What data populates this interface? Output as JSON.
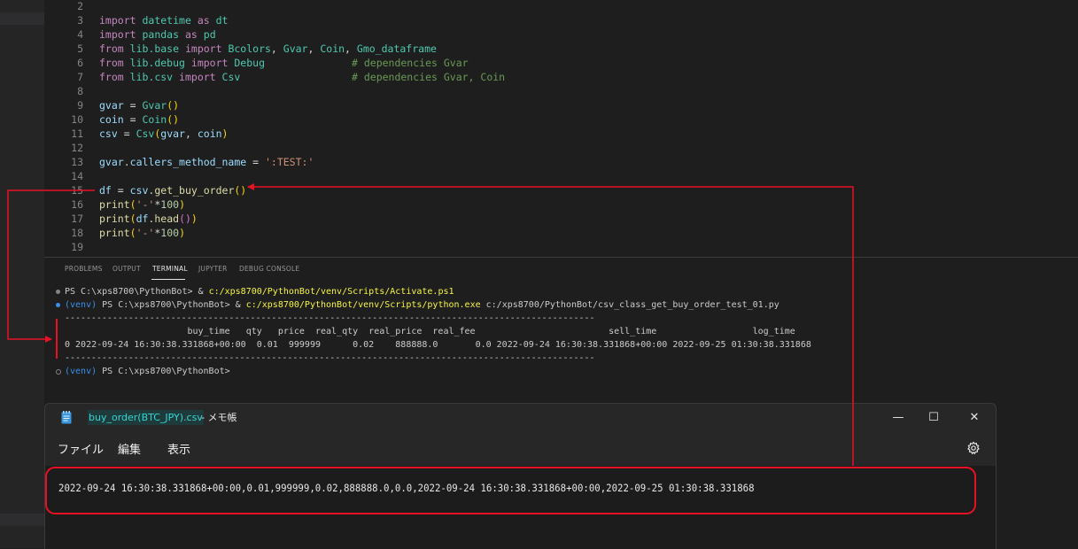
{
  "editor": {
    "lines": [
      {
        "n": "2"
      },
      {
        "n": "3"
      },
      {
        "n": "4"
      },
      {
        "n": "5"
      },
      {
        "n": "6"
      },
      {
        "n": "7"
      },
      {
        "n": "8"
      },
      {
        "n": "9"
      },
      {
        "n": "10"
      },
      {
        "n": "11"
      },
      {
        "n": "12"
      },
      {
        "n": "13"
      },
      {
        "n": "14"
      },
      {
        "n": "15"
      },
      {
        "n": "16"
      },
      {
        "n": "17"
      },
      {
        "n": "18"
      },
      {
        "n": "19"
      }
    ],
    "code": {
      "l3": {
        "kw": "import",
        "mod": "datetime",
        "as": "as",
        "alias": "dt"
      },
      "l4": {
        "kw": "import",
        "mod": "pandas",
        "as": "as",
        "alias": "pd"
      },
      "l5": {
        "from": "from",
        "mod": "lib.base",
        "imp": "import",
        "names": [
          "Bcolors",
          ", ",
          "Gvar",
          ", ",
          "Coin",
          ", ",
          "Gmo_dataframe"
        ]
      },
      "l6": {
        "from": "from",
        "mod": "lib.debug",
        "imp": "import",
        "name": "Debug",
        "comment": "# dependencies Gvar"
      },
      "l7": {
        "from": "from",
        "mod": "lib.csv",
        "imp": "import",
        "name": "Csv",
        "comment": "# dependencies Gvar, Coin"
      },
      "l9": {
        "var": "gvar",
        "eq": " = ",
        "cls": "Gvar",
        "p": "()"
      },
      "l10": {
        "var": "coin",
        "eq": " = ",
        "cls": "Coin",
        "p": "()"
      },
      "l11": {
        "var": "csv",
        "eq": " = ",
        "cls": "Csv",
        "po": "(",
        "a1": "gvar",
        ", ": ", ",
        "a2": "coin",
        "pc": ")"
      },
      "l13": {
        "var": "gvar",
        "dot": ".",
        "attr": "callers_method_name",
        "eq": " = ",
        "str": "':TEST:'"
      },
      "l15": {
        "var": "df",
        "eq": " = ",
        "obj": "csv",
        "dot": ".",
        "fn": "get_buy_order",
        "p": "()"
      },
      "l16": {
        "fn": "print",
        "po": "(",
        "str": "'-'",
        "op": "*",
        "num": "100",
        "pc": ")"
      },
      "l17": {
        "fn": "print",
        "po": "(",
        "obj": "df",
        "dot": ".",
        "fn2": "head",
        "p2": "()",
        "pc": ")"
      },
      "l18": {
        "fn": "print",
        "po": "(",
        "str": "'-'",
        "op": "*",
        "num": "100",
        "pc": ")"
      }
    }
  },
  "panel": {
    "tabs": [
      "PROBLEMS",
      "OUTPUT",
      "TERMINAL",
      "JUPYTER",
      "DEBUG CONSOLE"
    ],
    "active_tab": "TERMINAL"
  },
  "terminal": {
    "l1_prompt": "PS C:\\xps8700\\PythonBot> & ",
    "l1_path": "c:/xps8700/PythonBot/venv/Scripts/Activate.ps1",
    "l2_venv": "(venv)",
    "l2_prompt": " PS C:\\xps8700\\PythonBot> & ",
    "l2_path": "c:/xps8700/PythonBot/venv/Scripts/python.exe",
    "l2_rest": " c:/xps8700/PythonBot/csv_class_get_buy_order_test_01.py",
    "sep": "----------------------------------------------------------------------------------------------------",
    "header": "                       buy_time   qty   price  real_qty  real_price  real_fee                         sell_time                  log_time",
    "row": "0 2022-09-24 16:30:38.331868+00:00  0.01  999999      0.02    888888.0       0.0 2022-09-24 16:30:38.331868+00:00 2022-09-25 01:30:38.331868",
    "sep2": "----------------------------------------------------------------------------------------------------",
    "l_last_venv": "(venv)",
    "l_last_prompt": " PS C:\\xps8700\\PythonBot>"
  },
  "notepad": {
    "filename": "buy_order(BTC_JPY).csv",
    "appname": " - メモ帳",
    "menu": [
      "ファイル",
      "編集",
      "表示"
    ],
    "content": "2022-09-24 16:30:38.331868+00:00,0.01,999999,0.02,888888.0,0.0,2022-09-24 16:30:38.331868+00:00,2022-09-25 01:30:38.331868",
    "minimize": "—",
    "maximize": "☐",
    "close": "✕"
  },
  "colors": {
    "annotation_red": "#e81123",
    "filename_cyan": "#33d6d6"
  },
  "icons": [
    "notepad-icon",
    "gear-icon",
    "minimize-icon",
    "maximize-icon",
    "close-icon",
    "terminal-dot-icon"
  ]
}
